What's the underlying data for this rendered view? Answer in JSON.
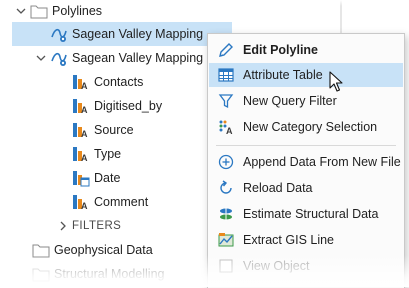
{
  "tree": {
    "polylines_folder": "Polylines",
    "polyline_item": "Sagean Valley Mapping",
    "polyline_table": "Sagean Valley Mapping (v",
    "columns": [
      "Contacts",
      "Digitised_by",
      "Source",
      "Type",
      "Date",
      "Comment"
    ],
    "filters_label": "FILTERS",
    "geophysical_folder": "Geophysical Data",
    "structural_folder": "Structural Modelling"
  },
  "menu": {
    "edit_polyline": "Edit Polyline",
    "attribute_table": "Attribute Table",
    "new_query_filter": "New Query Filter",
    "new_category_selection": "New Category Selection",
    "append_data": "Append Data From New File",
    "reload_data": "Reload Data",
    "estimate_structural": "Estimate Structural Data",
    "extract_gis": "Extract GIS Line",
    "view_object": "View Object"
  },
  "colors": {
    "selection": "#c8e2f7",
    "icon_blue": "#2b78c2",
    "icon_orange": "#e8891c",
    "icon_green": "#3c9a4a"
  }
}
